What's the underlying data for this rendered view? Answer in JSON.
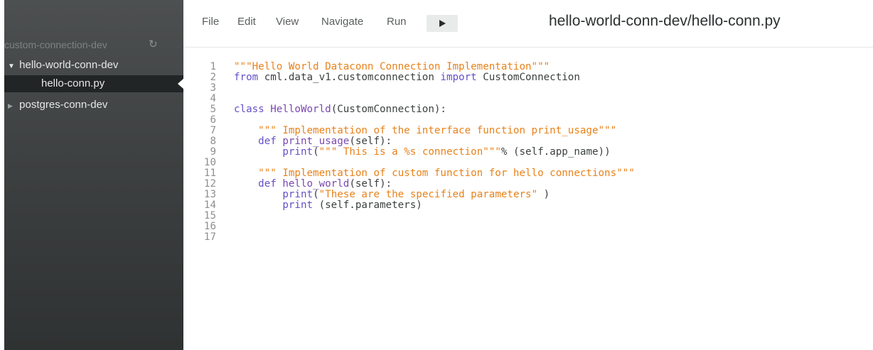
{
  "sidebar": {
    "project_name": "custom-connection-dev",
    "refresh_icon": "refresh-icon",
    "items": [
      {
        "label": "hello-world-conn-dev",
        "type": "folder",
        "expanded": true
      },
      {
        "label": "hello-conn.py",
        "type": "file",
        "selected": true
      },
      {
        "label": "postgres-conn-dev",
        "type": "folder",
        "expanded": false
      }
    ]
  },
  "menubar": {
    "items": [
      "File",
      "Edit",
      "View",
      "Navigate",
      "Run"
    ],
    "run_icon": "play-icon",
    "file_path": "hello-world-conn-dev/hello-conn.py"
  },
  "editor": {
    "lines": [
      {
        "n": "1",
        "tokens": [
          {
            "t": "\"\"\"Hello World Dataconn Connection Implementation\"\"\"",
            "c": "str"
          }
        ]
      },
      {
        "n": "2",
        "tokens": [
          {
            "t": "from",
            "c": "kw"
          },
          {
            "t": " cml.data_v1.customconnection ",
            "c": "plain"
          },
          {
            "t": "import",
            "c": "kw"
          },
          {
            "t": " CustomConnection",
            "c": "plain"
          }
        ]
      },
      {
        "n": "3",
        "tokens": []
      },
      {
        "n": "4",
        "tokens": []
      },
      {
        "n": "5",
        "tokens": [
          {
            "t": "class",
            "c": "kw"
          },
          {
            "t": " ",
            "c": "plain"
          },
          {
            "t": "HelloWorld",
            "c": "def"
          },
          {
            "t": "(CustomConnection):",
            "c": "plain"
          }
        ]
      },
      {
        "n": "6",
        "tokens": []
      },
      {
        "n": "7",
        "tokens": [
          {
            "t": "    ",
            "c": "plain"
          },
          {
            "t": "\"\"\" Implementation of the interface function print_usage\"\"\"",
            "c": "str"
          }
        ]
      },
      {
        "n": "8",
        "tokens": [
          {
            "t": "    ",
            "c": "plain"
          },
          {
            "t": "def",
            "c": "kw"
          },
          {
            "t": " ",
            "c": "plain"
          },
          {
            "t": "print_usage",
            "c": "def"
          },
          {
            "t": "(self):",
            "c": "plain"
          }
        ]
      },
      {
        "n": "9",
        "tokens": [
          {
            "t": "        ",
            "c": "plain"
          },
          {
            "t": "print",
            "c": "kw"
          },
          {
            "t": "(",
            "c": "plain"
          },
          {
            "t": "\"\"\" This is a %s connection\"\"\"",
            "c": "str"
          },
          {
            "t": "% (self.app_name))",
            "c": "plain"
          }
        ]
      },
      {
        "n": "10",
        "tokens": []
      },
      {
        "n": "11",
        "tokens": [
          {
            "t": "    ",
            "c": "plain"
          },
          {
            "t": "\"\"\" Implementation of custom function for hello connections\"\"\"",
            "c": "str"
          }
        ]
      },
      {
        "n": "12",
        "tokens": [
          {
            "t": "    ",
            "c": "plain"
          },
          {
            "t": "def",
            "c": "kw"
          },
          {
            "t": " ",
            "c": "plain"
          },
          {
            "t": "hello_world",
            "c": "def"
          },
          {
            "t": "(self):",
            "c": "plain"
          }
        ]
      },
      {
        "n": "13",
        "tokens": [
          {
            "t": "        ",
            "c": "plain"
          },
          {
            "t": "print",
            "c": "kw"
          },
          {
            "t": "(",
            "c": "plain"
          },
          {
            "t": "\"These are the specified parameters\"",
            "c": "str"
          },
          {
            "t": " )",
            "c": "plain"
          }
        ]
      },
      {
        "n": "14",
        "tokens": [
          {
            "t": "        ",
            "c": "plain"
          },
          {
            "t": "print",
            "c": "kw"
          },
          {
            "t": " (self.parameters)",
            "c": "plain"
          }
        ]
      },
      {
        "n": "15",
        "tokens": []
      },
      {
        "n": "16",
        "tokens": []
      },
      {
        "n": "17",
        "tokens": []
      }
    ]
  },
  "colors": {
    "string": "#e8821a",
    "keyword": "#6650c8",
    "definition": "#7a48b0",
    "plain": "#3c4040",
    "line_number": "#8c9090",
    "sidebar_bg": "#3e4141",
    "selected_bg": "#222525"
  }
}
